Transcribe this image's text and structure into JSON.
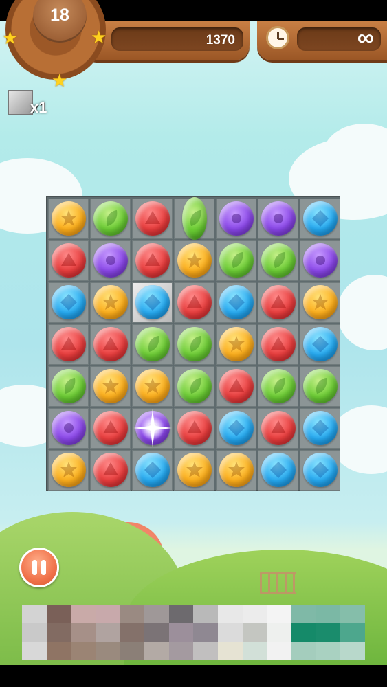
{
  "hud": {
    "level": "18",
    "score": "1370",
    "timer": "∞",
    "level_stars": 3
  },
  "booster": {
    "icon": "stone-block-icon",
    "count": "x1"
  },
  "board": {
    "rows": 7,
    "cols": 7,
    "gems": [
      [
        "yellow",
        "green",
        "red",
        "green",
        "purple",
        "purple",
        "blue"
      ],
      [
        "red",
        "purple",
        "red",
        "yellow",
        "green",
        "green",
        "purple"
      ],
      [
        "blue",
        "yellow",
        "blue",
        "red",
        "blue",
        "red",
        "yellow"
      ],
      [
        "red",
        "red",
        "green",
        "green",
        "yellow",
        "red",
        "blue"
      ],
      [
        "green",
        "yellow",
        "yellow",
        "green",
        "red",
        "green",
        "green"
      ],
      [
        "purple",
        "red",
        "purple",
        "red",
        "blue",
        "red",
        "blue"
      ],
      [
        "yellow",
        "red",
        "blue",
        "yellow",
        "yellow",
        "blue",
        "blue"
      ]
    ],
    "stone_cell": [
      2,
      2
    ],
    "stretched_gem": [
      0,
      3
    ],
    "sparkle_gem": [
      5,
      2
    ],
    "gem_symbols": {
      "red": "triangle",
      "green": "leaf",
      "yellow": "star",
      "blue": "diamond",
      "purple": "circle"
    }
  },
  "controls": {
    "pause_icon": "pause-icon"
  },
  "colors": {
    "red": "#e83d3d",
    "green": "#6ccc35",
    "yellow": "#fcae1c",
    "blue": "#26a9f0",
    "purple": "#8a47e8",
    "header_wood": "#b86f35"
  },
  "ad_banner": {
    "swatches": [
      "#d3d3d3",
      "#7a6058",
      "#c9aaa8",
      "#c8a9ab",
      "#9a8a82",
      "#9f9898",
      "#6d6a6e",
      "#b9b9b9",
      "#e8e8e8",
      "#ececec",
      "#f4f4f4",
      "#7fb9a7",
      "#7bb8a5",
      "#85beaa",
      "#c9c9c9",
      "#826b62",
      "#a69088",
      "#b0a3a0",
      "#84716a",
      "#7b7376",
      "#9c8f9b",
      "#8f8892",
      "#dbdbdb",
      "#c4c6c1",
      "#eef0ee",
      "#158a69",
      "#1a8c6c",
      "#4da78d",
      "#d8d8d8",
      "#8f7464",
      "#9b8474",
      "#9a8a7e",
      "#8b7f77",
      "#b3aaa5",
      "#a49aa0",
      "#c1bfbf",
      "#e6e3d3",
      "#d2e0d8",
      "#f2f2f2",
      "#a4cdbd",
      "#a9d1c1",
      "#b8d8cb"
    ]
  }
}
